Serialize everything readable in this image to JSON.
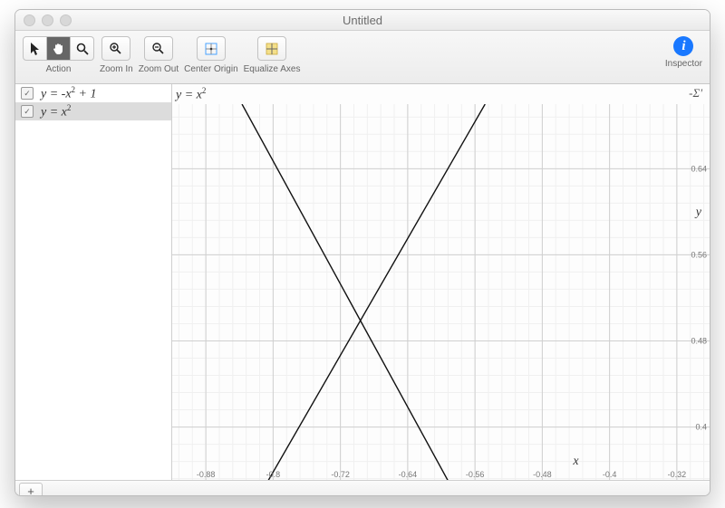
{
  "window": {
    "title": "Untitled"
  },
  "toolbar": {
    "action_label": "Action",
    "zoom_in_label": "Zoom In",
    "zoom_out_label": "Zoom Out",
    "center_label": "Center Origin",
    "equalize_label": "Equalize Axes",
    "inspector_label": "Inspector"
  },
  "sidebar": {
    "equations": [
      {
        "checked": true,
        "selected": false,
        "display_html": "y = -x<sup>2</sup> + 1"
      },
      {
        "checked": true,
        "selected": true,
        "display_html": "y = x<sup>2</sup>"
      }
    ]
  },
  "canvas": {
    "current_equation_html": "y = x<sup>2</sup>",
    "sigma_label": "-Σ'"
  },
  "footer": {
    "add_label": "+"
  },
  "chart_data": {
    "type": "line",
    "xlabel": "x",
    "ylabel": "y",
    "xlim": [
      -0.92,
      -0.28
    ],
    "ylim": [
      0.35,
      0.7
    ],
    "x_ticks": [
      -0.88,
      -0.8,
      -0.72,
      -0.64,
      -0.56,
      -0.48,
      -0.4,
      -0.32
    ],
    "y_ticks": [
      0.4,
      0.48,
      0.56,
      0.64
    ],
    "minor_grid_div": 5,
    "series": [
      {
        "name": "y = -x^2 + 1",
        "samples": [
          {
            "x": -0.806,
            "y": 0.35
          },
          {
            "x": -0.548,
            "y": 0.7
          }
        ]
      },
      {
        "name": "y = x^2",
        "samples": [
          {
            "x": -0.837,
            "y": 0.7
          },
          {
            "x": -0.592,
            "y": 0.35
          }
        ]
      }
    ]
  }
}
